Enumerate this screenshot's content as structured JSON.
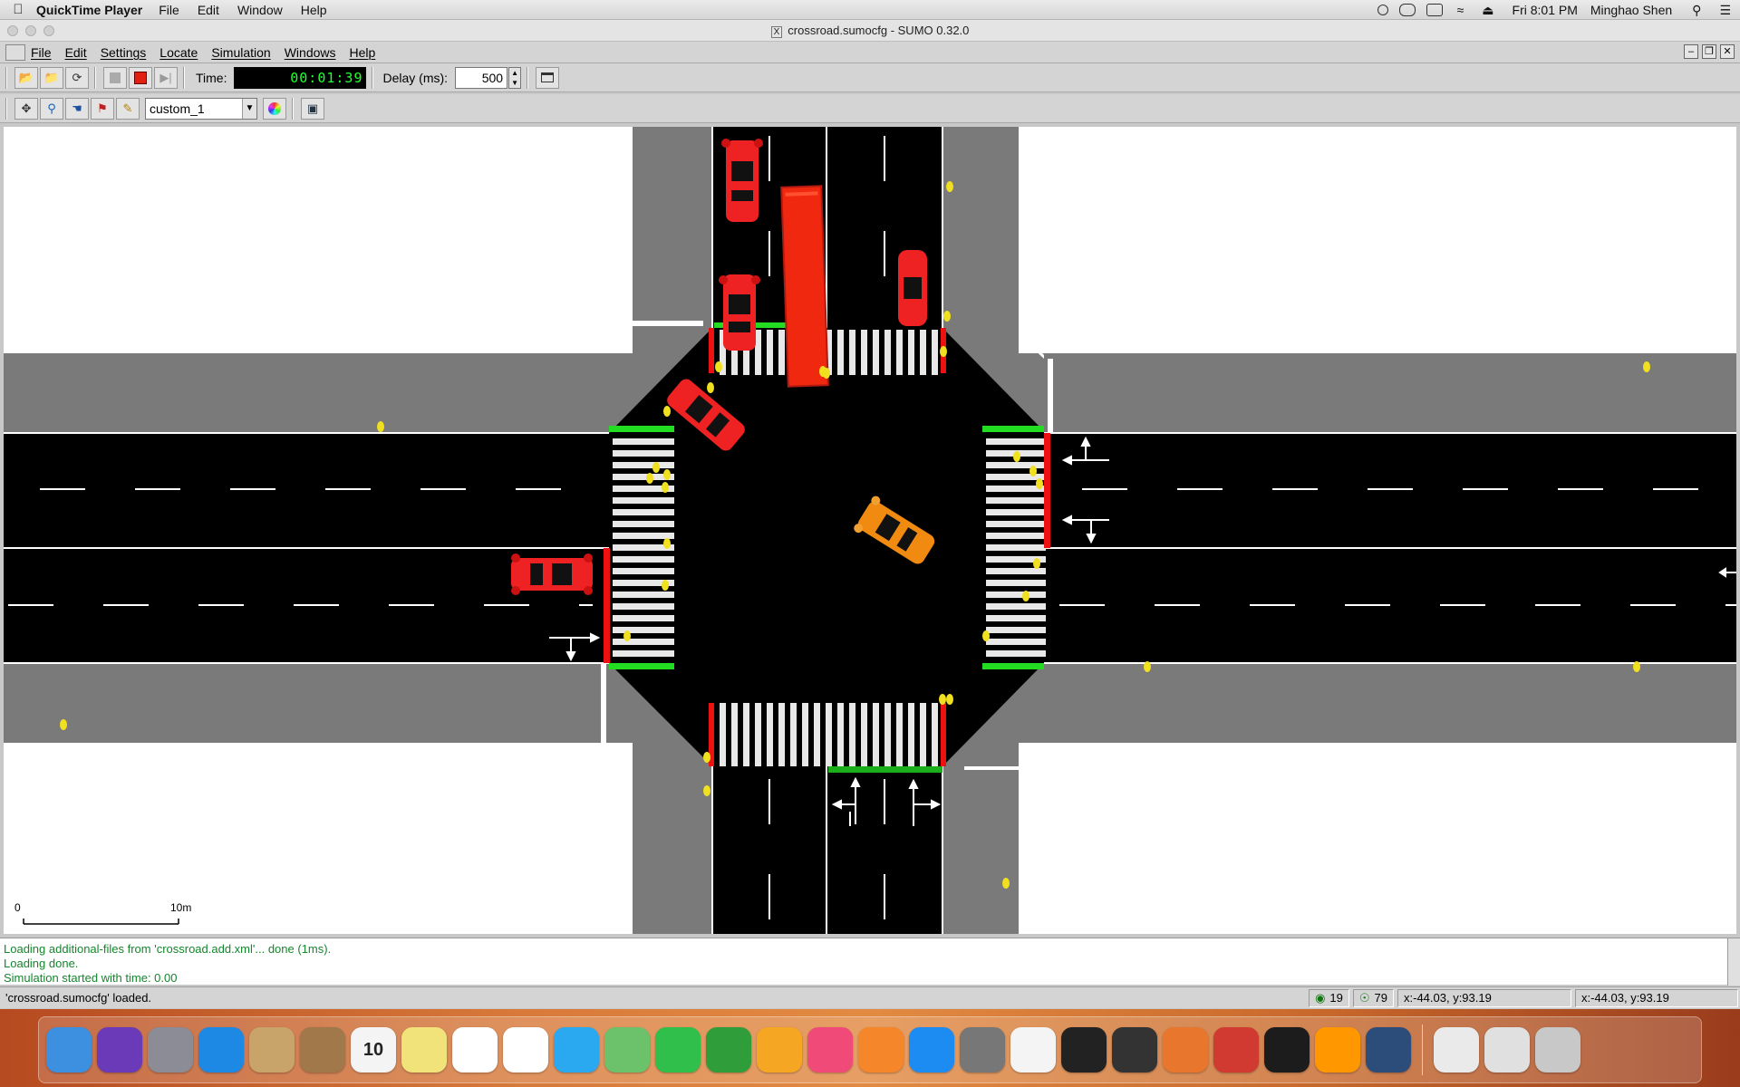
{
  "mac_menubar": {
    "app_name": "QuickTime Player",
    "menus": [
      "File",
      "Edit",
      "Window",
      "Help"
    ],
    "clock": "Fri 8:01 PM",
    "user": "Minghao Shen"
  },
  "window": {
    "title": "crossroad.sumocfg - SUMO 0.32.0",
    "x11_badge": "X"
  },
  "sumo_menus": [
    "File",
    "Edit",
    "Settings",
    "Locate",
    "Simulation",
    "Windows",
    "Help"
  ],
  "toolbar": {
    "time_label": "Time:",
    "time_value": "00:01:39",
    "delay_label": "Delay (ms):",
    "delay_value": "500",
    "color_scheme": "custom_1"
  },
  "canvas": {
    "scale_start": "0",
    "scale_end": "10m",
    "colors": {
      "road": "#000000",
      "sidewalk": "#7a7a7a",
      "crosswalk_stripe": "#e8e8e8",
      "signal_green": "#22dd22",
      "signal_red": "#ee1111",
      "vehicle_red": "#ee2222",
      "vehicle_orange": "#f08a10",
      "pedestrian": "#f0e020"
    }
  },
  "messages": [
    "Loading additional-files from 'crossroad.add.xml'... done (1ms).",
    "Loading done.",
    "Simulation started with time: 0.00"
  ],
  "statusbar": {
    "text": "'crossroad.sumocfg' loaded.",
    "vehicle_count": "19",
    "person_count": "79",
    "coords_1": "x:-44.03, y:93.19",
    "coords_2": "x:-44.03, y:93.19"
  },
  "dock_apps": [
    "finder",
    "siri",
    "launchpad",
    "safari",
    "mail",
    "contacts",
    "calendar",
    "notes",
    "reminders",
    "photos",
    "messages",
    "maps",
    "facetime",
    "numbers",
    "keynote",
    "itunes",
    "ibooks",
    "app-store",
    "system-preferences",
    "chrome",
    "terminal",
    "xquartz",
    "matlab",
    "remote-desktop",
    "activity-monitor",
    "sublime-text",
    "quicktime",
    "documents",
    "downloads-stack",
    "trash"
  ],
  "dock_calendar_day": "10"
}
